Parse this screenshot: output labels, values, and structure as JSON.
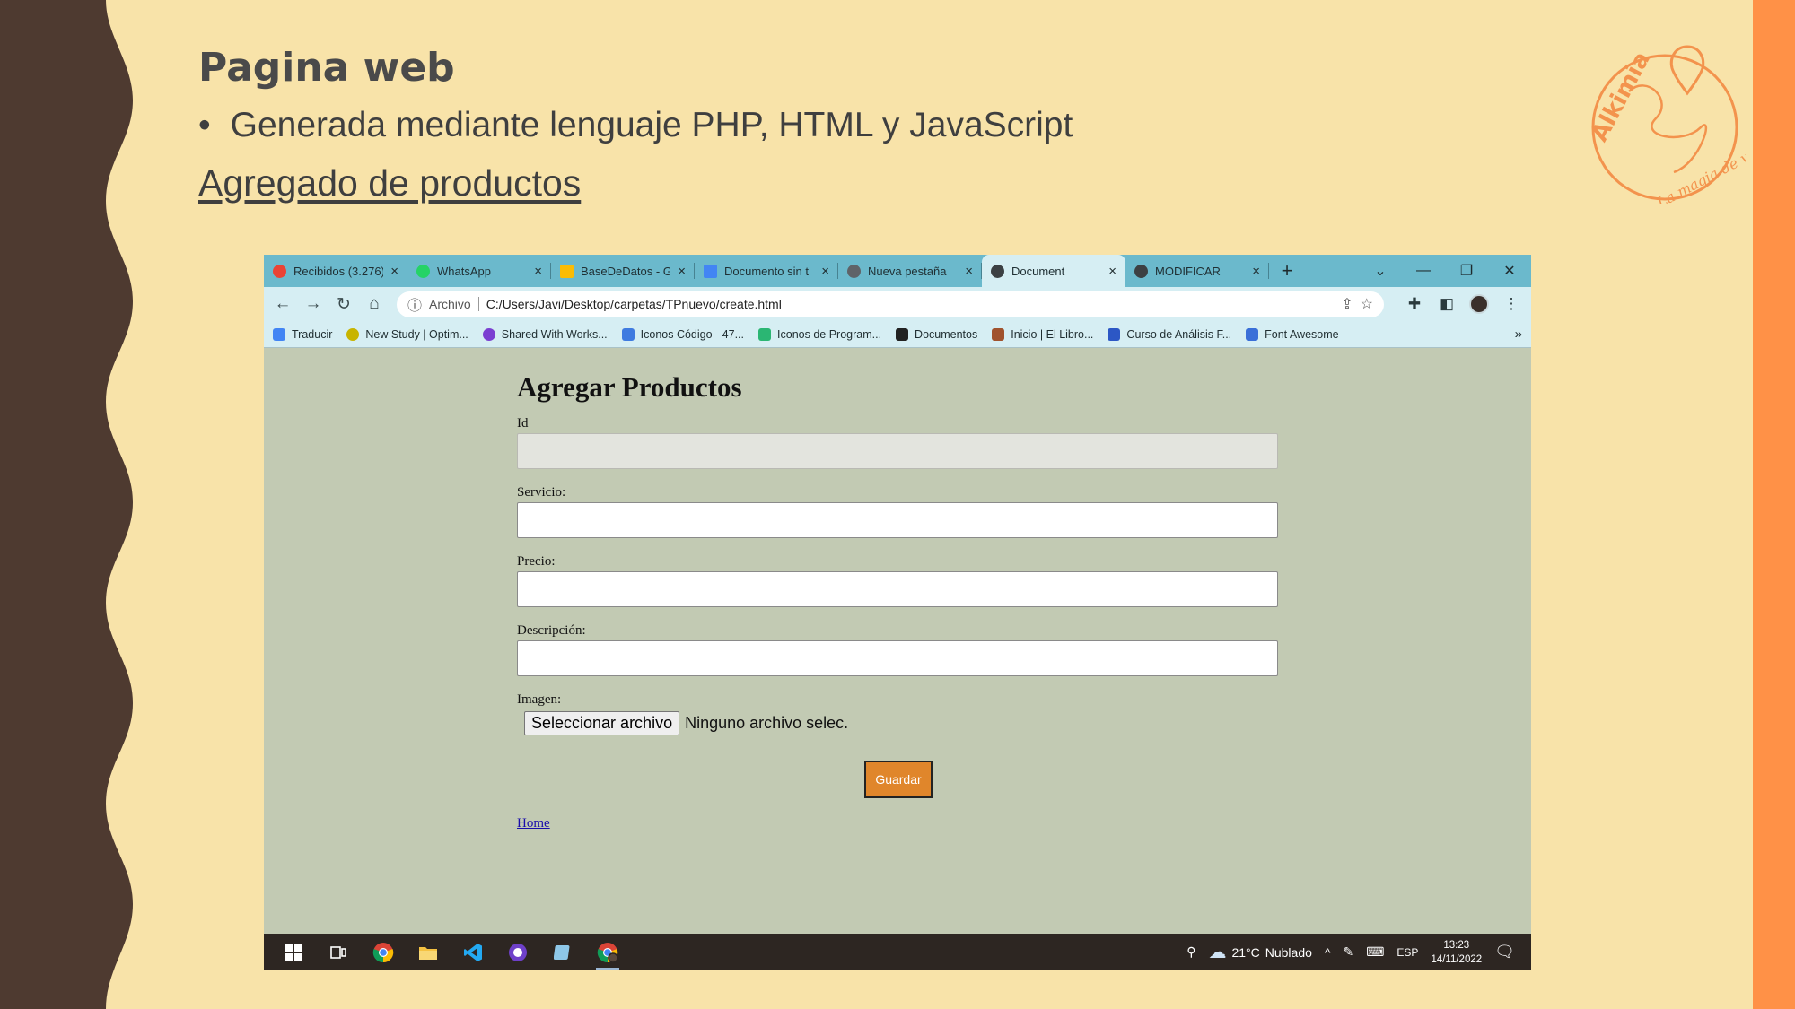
{
  "slide": {
    "title": "Pagina web",
    "bullet": "Generada mediante lenguaje PHP, HTML y JavaScript",
    "bullet_marker": "•",
    "subtitle_link": "Agregado de productos",
    "logo": {
      "brand": "Alkimia",
      "tagline": "La magia de viajar",
      "color": "#f3934d"
    },
    "colors": {
      "background": "#f8e3a9",
      "left_band": "#4e3a30",
      "right_stripe": "#ff9147"
    }
  },
  "browser": {
    "tabs": [
      {
        "label": "Recibidos (3.276)",
        "icon": "gmail-icon",
        "color": "#ea4335",
        "close": "×"
      },
      {
        "label": "WhatsApp",
        "icon": "whatsapp-icon",
        "color": "#25d366",
        "close": "×"
      },
      {
        "label": "BaseDeDatos - G",
        "icon": "drive-icon",
        "color": "#fbbc04",
        "close": "×"
      },
      {
        "label": "Documento sin t",
        "icon": "docs-icon",
        "color": "#4285f4",
        "close": "×"
      },
      {
        "label": "Nueva pestaña",
        "icon": "globe-icon",
        "color": "#5f6368",
        "close": "×"
      },
      {
        "label": "Document",
        "icon": "globe-icon",
        "color": "#3c4043",
        "close": "×",
        "active": true
      },
      {
        "label": "MODIFICAR",
        "icon": "globe-icon",
        "color": "#3c4043",
        "close": "×"
      }
    ],
    "new_tab": "+",
    "window_controls": {
      "dropdown": "⌄",
      "minimize": "—",
      "restore": "❐",
      "close": "✕"
    },
    "nav": {
      "back": "←",
      "forward": "→",
      "reload": "↻",
      "home": "⌂"
    },
    "address": {
      "security_label": "Archivo",
      "url": "C:/Users/Javi/Desktop/carpetas/TPnuevo/create.html"
    },
    "bookmarks": [
      {
        "label": "Traducir",
        "color": "#4285f4"
      },
      {
        "label": "New Study | Optim...",
        "color": "#c8b400"
      },
      {
        "label": "Shared With Works...",
        "color": "#7b3fd1"
      },
      {
        "label": "Iconos Código - 47...",
        "color": "#3f7be0"
      },
      {
        "label": "Iconos de Program...",
        "color": "#2bb673"
      },
      {
        "label": "Documentos",
        "color": "#222222"
      },
      {
        "label": "Inicio | El Libro...",
        "color": "#a0522d"
      },
      {
        "label": "Curso de Análisis F...",
        "color": "#2c57c5"
      },
      {
        "label": "Font Awesome",
        "color": "#3a6fd8"
      }
    ],
    "bookmarks_more": "»"
  },
  "form": {
    "heading": "Agregar Productos",
    "fields": {
      "id": {
        "label": "Id",
        "value": "",
        "readonly": true
      },
      "servicio": {
        "label": "Servicio:",
        "value": ""
      },
      "precio": {
        "label": "Precio:",
        "value": ""
      },
      "descripcion": {
        "label": "Descripción:",
        "value": ""
      }
    },
    "imagen": {
      "label": "Imagen:",
      "button": "Seleccionar archivo",
      "status": "Ninguno archivo selec."
    },
    "save_button": "Guardar",
    "save_color": "#e0862b",
    "home_link": "Home"
  },
  "taskbar": {
    "apps": [
      "windows-start-icon",
      "task-view-icon",
      "chrome-icon",
      "file-explorer-icon",
      "vscode-icon",
      "github-desktop-icon",
      "notepad-icon",
      "chrome-profile-icon"
    ],
    "weather": {
      "temp": "21°C",
      "condition": "Nublado"
    },
    "language": "ESP",
    "time": "13:23",
    "date": "14/11/2022"
  }
}
